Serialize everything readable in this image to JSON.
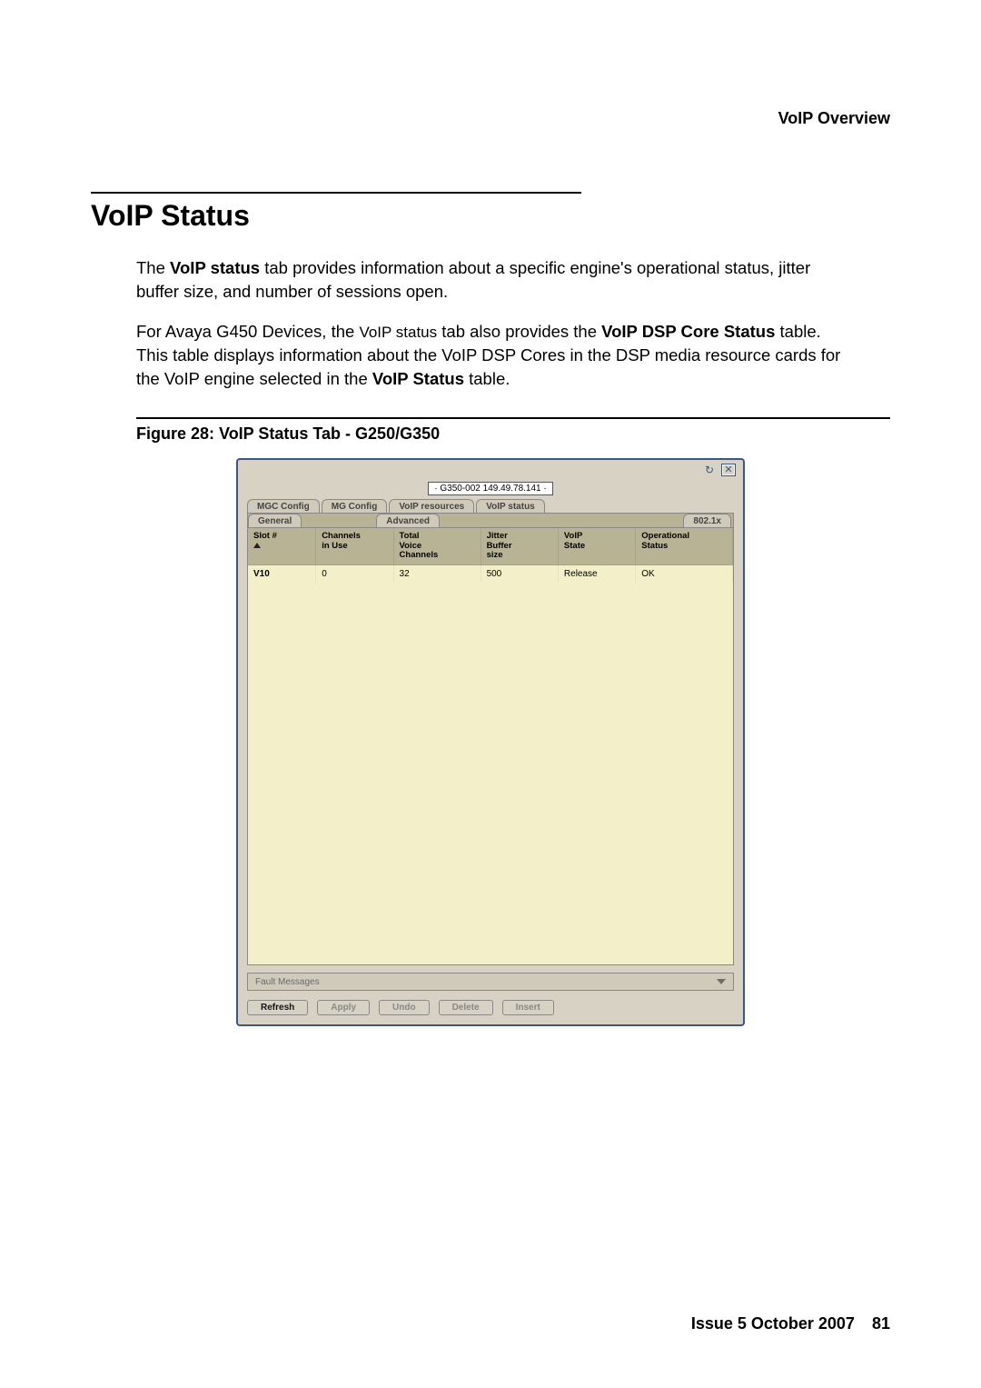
{
  "header": {
    "running_title": "VoIP Overview"
  },
  "section": {
    "title": "VoIP Status"
  },
  "paragraphs": {
    "p1_a": "The ",
    "p1_b_bold": "VoIP status",
    "p1_c": " tab provides information about a specific engine's operational status, jitter buffer size, and number of sessions open.",
    "p2_a": "For Avaya G450 Devices, the ",
    "p2_b_small": "VoIP status",
    "p2_c": " tab also provides the ",
    "p2_d_bold": "VoIP DSP Core Status",
    "p2_e": " table. This table displays information about the VoIP DSP Cores in the DSP media resource cards for the VoIP engine selected in the ",
    "p2_f_bold": "VoIP Status",
    "p2_g": " table."
  },
  "figure": {
    "caption": "Figure 28: VoIP Status Tab - G250/G350"
  },
  "screenshot": {
    "address": "· G350-002 149.49.78.141 ·",
    "upper_tabs": {
      "t1": "MGC Config",
      "t2": "MG Config",
      "t3": "VoIP resources",
      "t4": "VoIP status"
    },
    "lower_tabs": {
      "t1": "General",
      "t2": "Advanced",
      "t3": "802.1x"
    },
    "table": {
      "headers": {
        "h1": "Slot #",
        "h2a": "Channels",
        "h2b": "in Use",
        "h3a": "Total",
        "h3b": "Voice",
        "h3c": "Channels",
        "h4a": "Jitter",
        "h4b": "Buffer",
        "h4c": "size",
        "h5a": "VoIP",
        "h5b": "State",
        "h6a": "Operational",
        "h6b": "Status"
      },
      "rows": [
        {
          "slot": "V10",
          "channels_in_use": "0",
          "total_voice_channels": "32",
          "jitter": "500",
          "voip_state": "Release",
          "op_status": "OK"
        }
      ]
    },
    "fault_label": "Fault Messages",
    "buttons": {
      "refresh": "Refresh",
      "apply": "Apply",
      "undo": "Undo",
      "delete": "Delete",
      "insert": "Insert"
    },
    "icons": {
      "refresh": "refresh-icon",
      "close": "close-icon"
    }
  },
  "footer": {
    "issue": "Issue 5   October 2007",
    "page": "81"
  }
}
